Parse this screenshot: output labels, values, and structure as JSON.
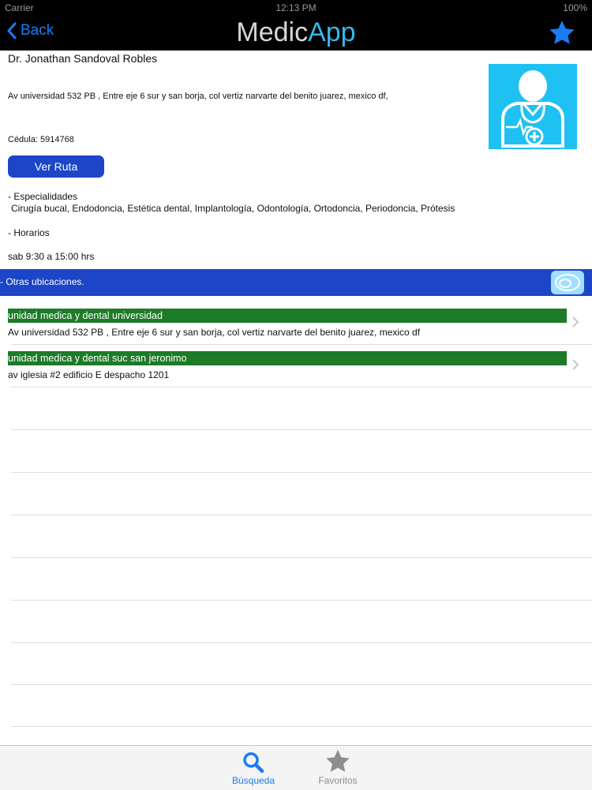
{
  "status": {
    "carrier": "Carrier",
    "time": "12:13 PM",
    "battery": "100%"
  },
  "nav": {
    "back_label": "Back",
    "title_part1": "Medic",
    "title_part2": "App"
  },
  "doctor": {
    "name": "Dr. Jonathan Sandoval Robles",
    "address": "Av universidad 532 PB , Entre eje 6 sur y san borja, col vertiz narvarte del benito juarez, mexico df,",
    "cedula_label": "Cédula:",
    "cedula_value": "5914768"
  },
  "route_button": "Ver Ruta",
  "specialties": {
    "heading": "- Especialidades",
    "value": "Cirugía bucal, Endodoncia, Estética dental, Implantología, Odontología, Ortodoncia, Periodoncia, Prótesis"
  },
  "schedule": {
    "heading": "- Horarios",
    "value": "sab 9:30 a 15:00 hrs"
  },
  "other_locations": {
    "heading": "- Otras ubicaciones.",
    "items": [
      {
        "name": "unidad medica y dental universidad",
        "address": "Av universidad 532 PB , Entre eje 6 sur y san borja, col vertiz narvarte del benito juarez, mexico df"
      },
      {
        "name": "unidad medica y dental suc san jeronimo",
        "address": "av iglesia #2 edificio E despacho 1201"
      }
    ]
  },
  "tabs": [
    {
      "label": "Búsqueda",
      "icon": "search-icon",
      "selected": true
    },
    {
      "label": "Favoritos",
      "icon": "star-icon",
      "selected": false
    }
  ],
  "colors": {
    "accent": "#1a7cf2",
    "section": "#1c45c8",
    "location_name_bg": "#1d7b28",
    "avatar_bg": "#1fc1f3"
  }
}
